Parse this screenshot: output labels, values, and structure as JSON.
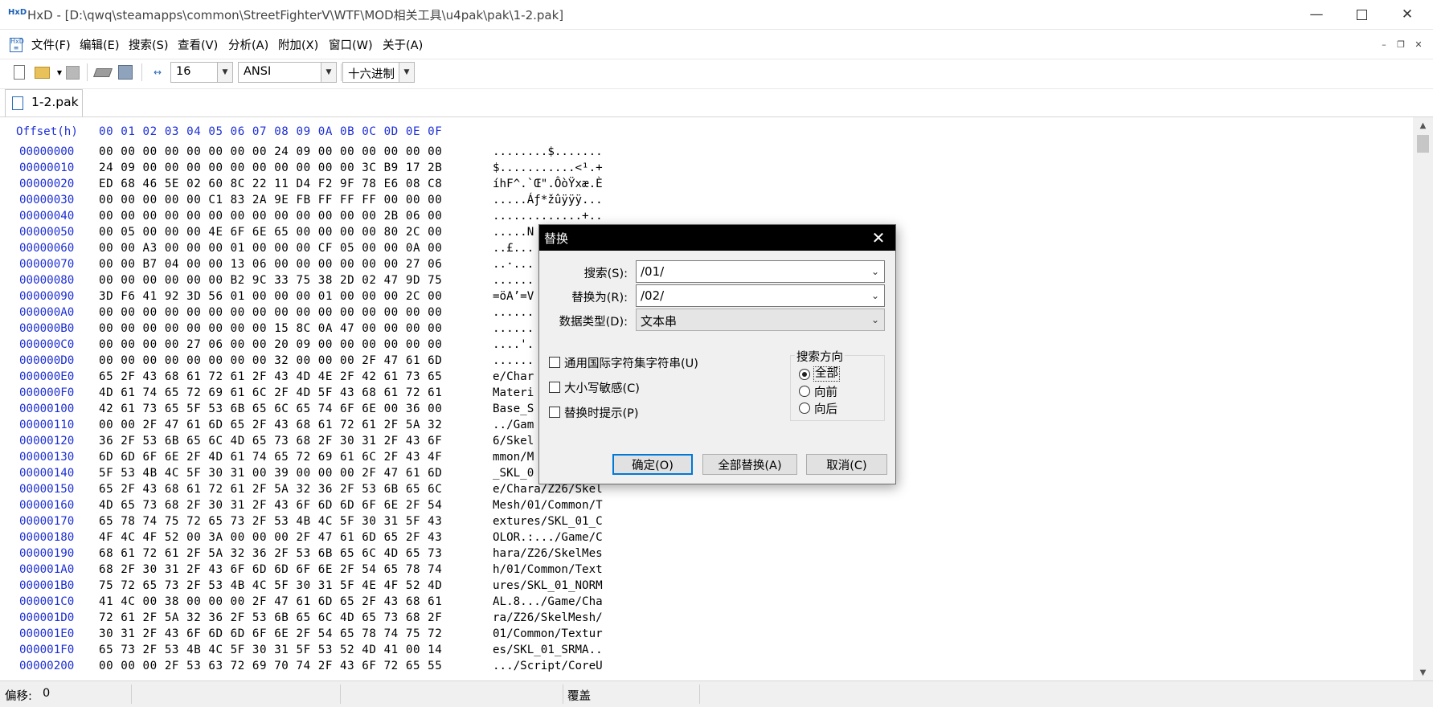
{
  "window": {
    "title": "HxD - [D:\\qwq\\steamapps\\common\\StreetFighterV\\WTF\\MOD相关工具\\u4pak\\pak\\1-2.pak]",
    "app_icon_text": "HxD"
  },
  "menu": [
    "文件(F)",
    "编辑(E)",
    "搜索(S)",
    "查看(V)",
    "分析(A)",
    "附加(X)",
    "窗口(W)",
    "关于(A)"
  ],
  "toolbar": {
    "bytes_per_row": "16",
    "charset": "ANSI",
    "offset_base": "十六进制"
  },
  "tab": {
    "label": "1-2.pak"
  },
  "hex": {
    "header_offset": "Offset(h)",
    "header_cols": "00 01 02 03 04 05 06 07 08 09 0A 0B 0C 0D 0E 0F",
    "rows": [
      {
        "off": "00000000",
        "hex": "00 00 00 00 00 00 00 00 24 09 00 00 00 00 00 00",
        "txt": "........$......."
      },
      {
        "off": "00000010",
        "hex": "24 09 00 00 00 00 00 00 00 00 00 00 3C B9 17 2B",
        "txt": "$...........<¹.+"
      },
      {
        "off": "00000020",
        "hex": "ED 68 46 5E 02 60 8C 22 11 D4 F2 9F 78 E6 08 C8",
        "txt": "íhF^.`Œ\".ÔòŸxæ.È"
      },
      {
        "off": "00000030",
        "hex": "00 00 00 00 00 C1 83 2A 9E FB FF FF FF 00 00 00",
        "txt": ".....Áƒ*žûÿÿÿ..."
      },
      {
        "off": "00000040",
        "hex": "00 00 00 00 00 00 00 00 00 00 00 00 00 2B 06 00",
        "txt": ".............+.."
      },
      {
        "off": "00000050",
        "hex": "00 05 00 00 00 4E 6F 6E 65 00 00 00 00 80 2C 00",
        "txt": ".....N"
      },
      {
        "off": "00000060",
        "hex": "00 00 A3 00 00 00 01 00 00 00 CF 05 00 00 0A 00",
        "txt": "..£..."
      },
      {
        "off": "00000070",
        "hex": "00 00 B7 04 00 00 13 06 00 00 00 00 00 00 27 06",
        "txt": "..·..."
      },
      {
        "off": "00000080",
        "hex": "00 00 00 00 00 00 B2 9C 33 75 38 2D 02 47 9D 75",
        "txt": "......"
      },
      {
        "off": "00000090",
        "hex": "3D F6 41 92 3D 56 01 00 00 00 01 00 00 00 2C 00",
        "txt": "=öA’=V"
      },
      {
        "off": "000000A0",
        "hex": "00 00 00 00 00 00 00 00 00 00 00 00 00 00 00 00",
        "txt": "......"
      },
      {
        "off": "000000B0",
        "hex": "00 00 00 00 00 00 00 00 15 8C 0A 47 00 00 00 00",
        "txt": "......"
      },
      {
        "off": "000000C0",
        "hex": "00 00 00 00 27 06 00 00 20 09 00 00 00 00 00 00",
        "txt": "....'."
      },
      {
        "off": "000000D0",
        "hex": "00 00 00 00 00 00 00 00 32 00 00 00 2F 47 61 6D",
        "txt": "......"
      },
      {
        "off": "000000E0",
        "hex": "65 2F 43 68 61 72 61 2F 43 4D 4E 2F 42 61 73 65",
        "txt": "e/Char"
      },
      {
        "off": "000000F0",
        "hex": "4D 61 74 65 72 69 61 6C 2F 4D 5F 43 68 61 72 61",
        "txt": "Materi"
      },
      {
        "off": "00000100",
        "hex": "42 61 73 65 5F 53 6B 65 6C 65 74 6F 6E 00 36 00",
        "txt": "Base_S"
      },
      {
        "off": "00000110",
        "hex": "00 00 2F 47 61 6D 65 2F 43 68 61 72 61 2F 5A 32",
        "txt": "../Gam"
      },
      {
        "off": "00000120",
        "hex": "36 2F 53 6B 65 6C 4D 65 73 68 2F 30 31 2F 43 6F",
        "txt": "6/Skel"
      },
      {
        "off": "00000130",
        "hex": "6D 6D 6F 6E 2F 4D 61 74 65 72 69 61 6C 2F 43 4F",
        "txt": "mmon/M"
      },
      {
        "off": "00000140",
        "hex": "5F 53 4B 4C 5F 30 31 00 39 00 00 00 2F 47 61 6D",
        "txt": "_SKL_0"
      },
      {
        "off": "00000150",
        "hex": "65 2F 43 68 61 72 61 2F 5A 32 36 2F 53 6B 65 6C",
        "txt": "e/Chara/Z26/Skel"
      },
      {
        "off": "00000160",
        "hex": "4D 65 73 68 2F 30 31 2F 43 6F 6D 6D 6F 6E 2F 54",
        "txt": "Mesh/01/Common/T"
      },
      {
        "off": "00000170",
        "hex": "65 78 74 75 72 65 73 2F 53 4B 4C 5F 30 31 5F 43",
        "txt": "extures/SKL_01_C"
      },
      {
        "off": "00000180",
        "hex": "4F 4C 4F 52 00 3A 00 00 00 2F 47 61 6D 65 2F 43",
        "txt": "OLOR.:.../Game/C"
      },
      {
        "off": "00000190",
        "hex": "68 61 72 61 2F 5A 32 36 2F 53 6B 65 6C 4D 65 73",
        "txt": "hara/Z26/SkelMes"
      },
      {
        "off": "000001A0",
        "hex": "68 2F 30 31 2F 43 6F 6D 6D 6F 6E 2F 54 65 78 74",
        "txt": "h/01/Common/Text"
      },
      {
        "off": "000001B0",
        "hex": "75 72 65 73 2F 53 4B 4C 5F 30 31 5F 4E 4F 52 4D",
        "txt": "ures/SKL_01_NORM"
      },
      {
        "off": "000001C0",
        "hex": "41 4C 00 38 00 00 00 2F 47 61 6D 65 2F 43 68 61",
        "txt": "AL.8.../Game/Cha"
      },
      {
        "off": "000001D0",
        "hex": "72 61 2F 5A 32 36 2F 53 6B 65 6C 4D 65 73 68 2F",
        "txt": "ra/Z26/SkelMesh/"
      },
      {
        "off": "000001E0",
        "hex": "30 31 2F 43 6F 6D 6D 6F 6E 2F 54 65 78 74 75 72",
        "txt": "01/Common/Textur"
      },
      {
        "off": "000001F0",
        "hex": "65 73 2F 53 4B 4C 5F 30 31 5F 53 52 4D 41 00 14",
        "txt": "es/SKL_01_SRMA.."
      },
      {
        "off": "00000200",
        "hex": "00 00 00 2F 53 63 72 69 70 74 2F 43 6F 72 65 55",
        "txt": ".../Script/CoreU"
      }
    ]
  },
  "status": {
    "offset_label": "偏移:",
    "offset_value": "0",
    "mode": "覆盖"
  },
  "dialog": {
    "title": "替换",
    "search_label": "搜索(S):",
    "search_value": "/01/",
    "replace_label": "替换为(R):",
    "replace_value": "/02/",
    "datatype_label": "数据类型(D):",
    "datatype_value": "文本串",
    "opt_unicode": "通用国际字符集字符串(U)",
    "opt_case": "大小写敏感(C)",
    "opt_prompt": "替换时提示(P)",
    "direction_title": "搜索方向",
    "dir_all": "全部",
    "dir_forward": "向前",
    "dir_backward": "向后",
    "btn_ok": "确定(O)",
    "btn_replace_all": "全部替换(A)",
    "btn_cancel": "取消(C)"
  }
}
